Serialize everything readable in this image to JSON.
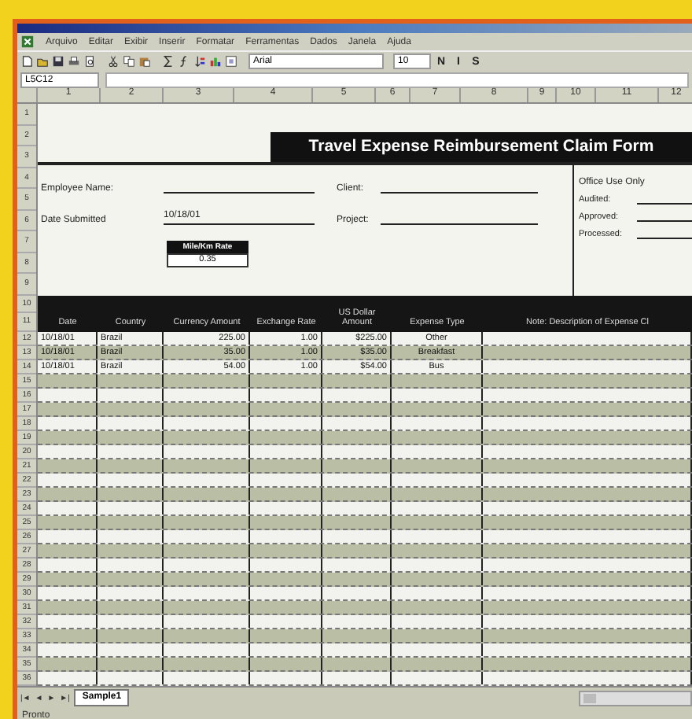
{
  "menu": [
    "Arquivo",
    "Editar",
    "Exibir",
    "Inserir",
    "Formatar",
    "Ferramentas",
    "Dados",
    "Janela",
    "Ajuda"
  ],
  "toolbar": {
    "font": "Arial",
    "size": "10",
    "format_buttons": [
      "N",
      "I",
      "S"
    ]
  },
  "name_box": "L5C12",
  "column_headers": [
    "1",
    "2",
    "3",
    "4",
    "5",
    "6",
    "7",
    "8",
    "9",
    "10",
    "11",
    "12"
  ],
  "row_numbers": [
    "1",
    "2",
    "3",
    "4",
    "5",
    "6",
    "7",
    "8",
    "9",
    "10",
    "11",
    "12",
    "13",
    "14",
    "15",
    "16",
    "17",
    "18",
    "19",
    "20",
    "21",
    "22",
    "23",
    "24",
    "25",
    "26",
    "27",
    "28",
    "29",
    "30",
    "31",
    "32",
    "33",
    "34",
    "35",
    "36"
  ],
  "form": {
    "title": "Travel Expense Reimbursement Claim Form",
    "left_fields": [
      {
        "label": "Employee Name:",
        "kind": "line"
      },
      {
        "label": "Date Submitted",
        "value": "10/18/01",
        "kind": "value"
      }
    ],
    "mid_fields": [
      {
        "label": "Client:"
      },
      {
        "label": "Project:"
      }
    ],
    "office": {
      "heading": "Office Use Only",
      "fields": [
        "Audited:",
        "Approved:",
        "Processed:"
      ]
    },
    "rate": {
      "label": "Mile/Km Rate",
      "value": "0.35"
    }
  },
  "table": {
    "columns": [
      "Date",
      "Country",
      "Currency Amount",
      "Exchange Rate",
      "US Dollar Amount",
      "Expense Type",
      "Note: Description of Expense Cl"
    ],
    "rows": [
      [
        "10/18/01",
        "Brazil",
        "225.00",
        "1.00",
        "$225.00",
        "Other"
      ],
      [
        "10/18/01",
        "Brazil",
        "35.00",
        "1.00",
        "$35.00",
        "Breakfast"
      ],
      [
        "10/18/01",
        "Brazil",
        "54.00",
        "1.00",
        "$54.00",
        "Bus"
      ]
    ]
  },
  "sheet_nav": [
    "|◄",
    "◄",
    "►",
    "►|"
  ],
  "sheet_tabs": [
    {
      "label": "Sample1",
      "selected": true
    }
  ],
  "status_bar": "Pronto"
}
